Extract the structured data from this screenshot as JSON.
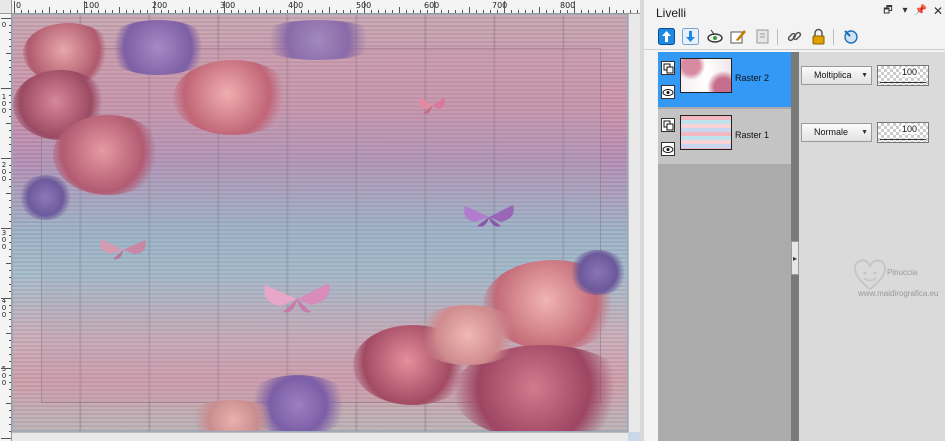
{
  "ruler": {
    "h_labels": [
      "0",
      "100",
      "200",
      "300",
      "400",
      "500",
      "600",
      "700",
      "800"
    ],
    "v_labels": [
      "0",
      "1 0 0",
      "2 0 0",
      "3 0 0",
      "4 0 0",
      "5 0 0"
    ]
  },
  "palette": {
    "title": "Livelli",
    "toolbar": [
      {
        "icon": "move-layer-up-icon",
        "color": "#1e88e5"
      },
      {
        "icon": "move-layer-down-icon",
        "color": "#1e88e5"
      },
      {
        "icon": "layer-visibility-icon",
        "color": "#3a9a3a"
      },
      {
        "icon": "edit-layer-icon",
        "color": "#c77800"
      },
      {
        "icon": "delete-layer-icon",
        "color": "#9a9a9a"
      },
      {
        "icon": "link-icon",
        "color": "#555555"
      },
      {
        "icon": "lock-icon",
        "color": "#e0a000"
      },
      {
        "icon": "layer-properties-icon",
        "color": "#1e6fb8"
      }
    ]
  },
  "layers": [
    {
      "name": "Raster 2",
      "blend_mode": "Moltiplica",
      "opacity": "100",
      "selected": true
    },
    {
      "name": "Raster 1",
      "blend_mode": "Normale",
      "opacity": "100",
      "selected": false
    }
  ],
  "watermark": {
    "name": "Pinuccia",
    "url": "www.maidirografica.eu"
  },
  "colors": {
    "selection": "#3399f5",
    "accent": "#1e88e5"
  }
}
